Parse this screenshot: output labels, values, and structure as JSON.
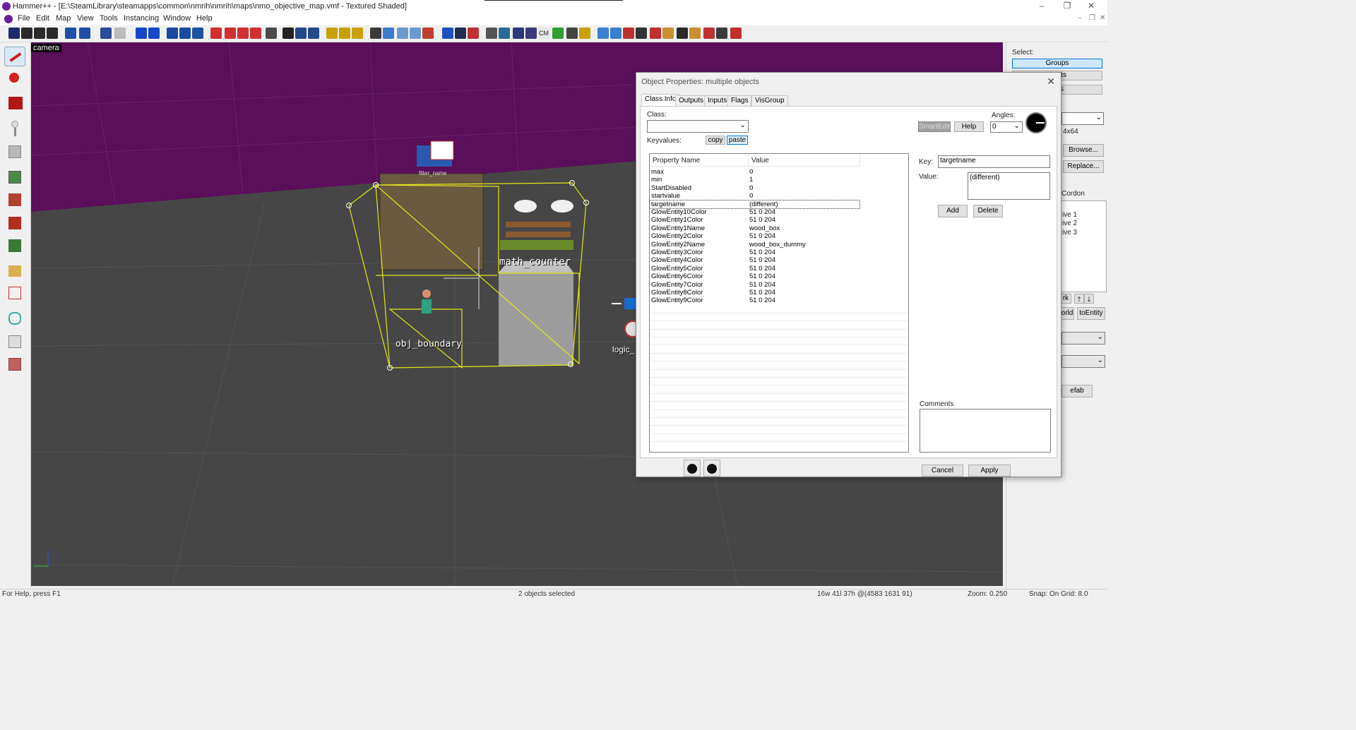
{
  "window": {
    "title": "Hammer++ - [E:\\SteamLibrary\\steamapps\\common\\nmrih\\nmrih\\maps\\nmo_objective_map.vmf - Textured Shaded]",
    "minimize": "–",
    "restore": "❐",
    "close": "✕"
  },
  "menu": [
    "File",
    "Edit",
    "Map",
    "View",
    "Tools",
    "Instancing",
    "Window",
    "Help"
  ],
  "viewport": {
    "camera_label": "camera",
    "entity_labels": {
      "filter": "filter_name",
      "math_counter": "math_counter",
      "obj_boundary": "obj_boundary",
      "logic": "logic_"
    },
    "colors": {
      "sky": "#5a0f5a",
      "floor": "#464646",
      "selection": "#e5e51a"
    }
  },
  "right_panel": {
    "select_label": "Select:",
    "groups_btn": "Groups",
    "objects_btn": "ts",
    "solids_btn": "s",
    "texture_size": "4x64",
    "browse_btn": "Browse...",
    "replace_btn": "Replace...",
    "cordon_label": "Cordon",
    "visgroups": [
      "ive 1",
      "ive 2",
      "ive 3"
    ],
    "mark_btn": "rk",
    "world_btn": "orld",
    "to_entity_btn": "toEntity",
    "prefab_btn": "efab"
  },
  "dialog": {
    "title": "Object Properties: multiple objects",
    "close": "✕",
    "tabs": [
      "Class Info",
      "Outputs",
      "Inputs",
      "Flags",
      "VisGroup"
    ],
    "class_label": "Class:",
    "class_value": "",
    "keyvalues_label": "Keyvalues:",
    "copy_btn": "copy",
    "paste_btn": "paste",
    "smartedit_btn": "SmartEdit",
    "help_btn": "Help",
    "angles_label": "Angles:",
    "angles_value": "0",
    "columns": {
      "name": "Property Name",
      "value": "Value"
    },
    "properties": [
      {
        "name": "max",
        "value": "0"
      },
      {
        "name": "min",
        "value": "1"
      },
      {
        "name": "StartDisabled",
        "value": "0"
      },
      {
        "name": "startvalue",
        "value": "0"
      },
      {
        "name": "targetname",
        "value": "(different)"
      },
      {
        "name": "GlowEntity10Color",
        "value": "51 0 204"
      },
      {
        "name": "GlowEntity1Color",
        "value": "51 0 204"
      },
      {
        "name": "GlowEntity1Name",
        "value": "wood_box"
      },
      {
        "name": "GlowEntity2Color",
        "value": "51 0 204"
      },
      {
        "name": "GlowEntity2Name",
        "value": "wood_box_dummy"
      },
      {
        "name": "GlowEntity3Color",
        "value": "51 0 204"
      },
      {
        "name": "GlowEntity4Color",
        "value": "51 0 204"
      },
      {
        "name": "GlowEntity5Color",
        "value": "51 0 204"
      },
      {
        "name": "GlowEntity6Color",
        "value": "51 0 204"
      },
      {
        "name": "GlowEntity7Color",
        "value": "51 0 204"
      },
      {
        "name": "GlowEntity8Color",
        "value": "51 0 204"
      },
      {
        "name": "GlowEntity9Color",
        "value": "51 0 204"
      }
    ],
    "selected_property": "targetname",
    "key_label": "Key:",
    "key_value": "targetname",
    "value_label": "Value:",
    "value_value": "(different)",
    "add_btn": "Add",
    "delete_btn": "Delete",
    "comments_label": "Comments",
    "cancel_btn": "Cancel",
    "apply_btn": "Apply"
  },
  "status": {
    "help": "For Help, press F1",
    "selection": "2 objects selected",
    "size": "16w 41l 37h @(4583 1631 91)",
    "zoom": "Zoom: 0.250",
    "snap": "Snap: On Grid: 8.0"
  }
}
